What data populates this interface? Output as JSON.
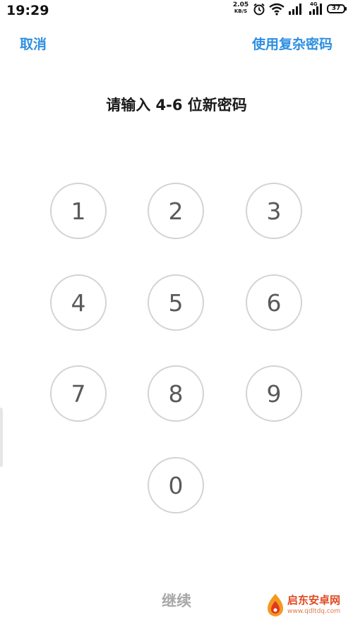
{
  "status_bar": {
    "time": "19:29",
    "speed_value": "2.05",
    "speed_unit": "KB/S",
    "network_tag": "4G",
    "battery": "37",
    "icons": [
      "alarm-icon",
      "wifi-icon",
      "signal-icon",
      "signal-icon"
    ]
  },
  "header": {
    "cancel_label": "取消",
    "complex_password_label": "使用复杂密码"
  },
  "prompt": "请输入 4-6 位新密码",
  "keypad": {
    "keys": [
      "1",
      "2",
      "3",
      "4",
      "5",
      "6",
      "7",
      "8",
      "9",
      "0"
    ]
  },
  "footer": {
    "continue_label": "继续"
  },
  "watermark": {
    "brand": "启东安卓网",
    "url": "www.qdltdq.com"
  },
  "colors": {
    "accent": "#2e8fe0",
    "key_border": "#d3d3d3",
    "key_text": "#5a5a5a",
    "disabled_text": "#a8a8a8"
  }
}
